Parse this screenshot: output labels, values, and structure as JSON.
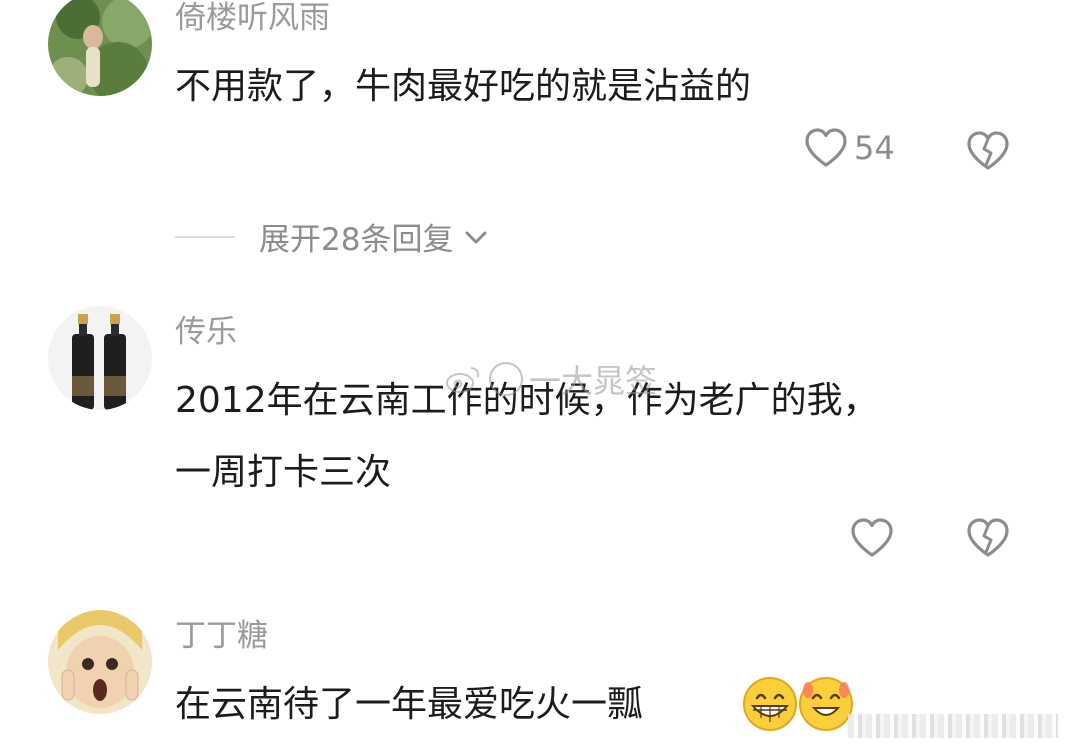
{
  "comments": [
    {
      "username": "倚楼听风雨",
      "text": "不用款了，牛肉最好吃的就是沾益的",
      "likes": "54",
      "expand_replies": "展开28条回复"
    },
    {
      "username": "传乐",
      "text_line1": "2012年在云南工作的时候，作为老广的我，",
      "text_line2": "一周打卡三次",
      "likes": ""
    },
    {
      "username": "丁丁糖",
      "text": "在云南待了一年最爱吃火一瓢",
      "emoji": [
        "grinning-face",
        "grin-sweat-face"
      ]
    }
  ],
  "watermark": "一大晁签",
  "icons": {
    "like": "heart-outline-icon",
    "dislike": "broken-heart-icon",
    "expand": "chevron-down-icon",
    "watermark": "weibo-icon"
  },
  "colors": {
    "username": "#9a9a9a",
    "text": "#1c1c1c",
    "icon": "#8c8c8c"
  }
}
